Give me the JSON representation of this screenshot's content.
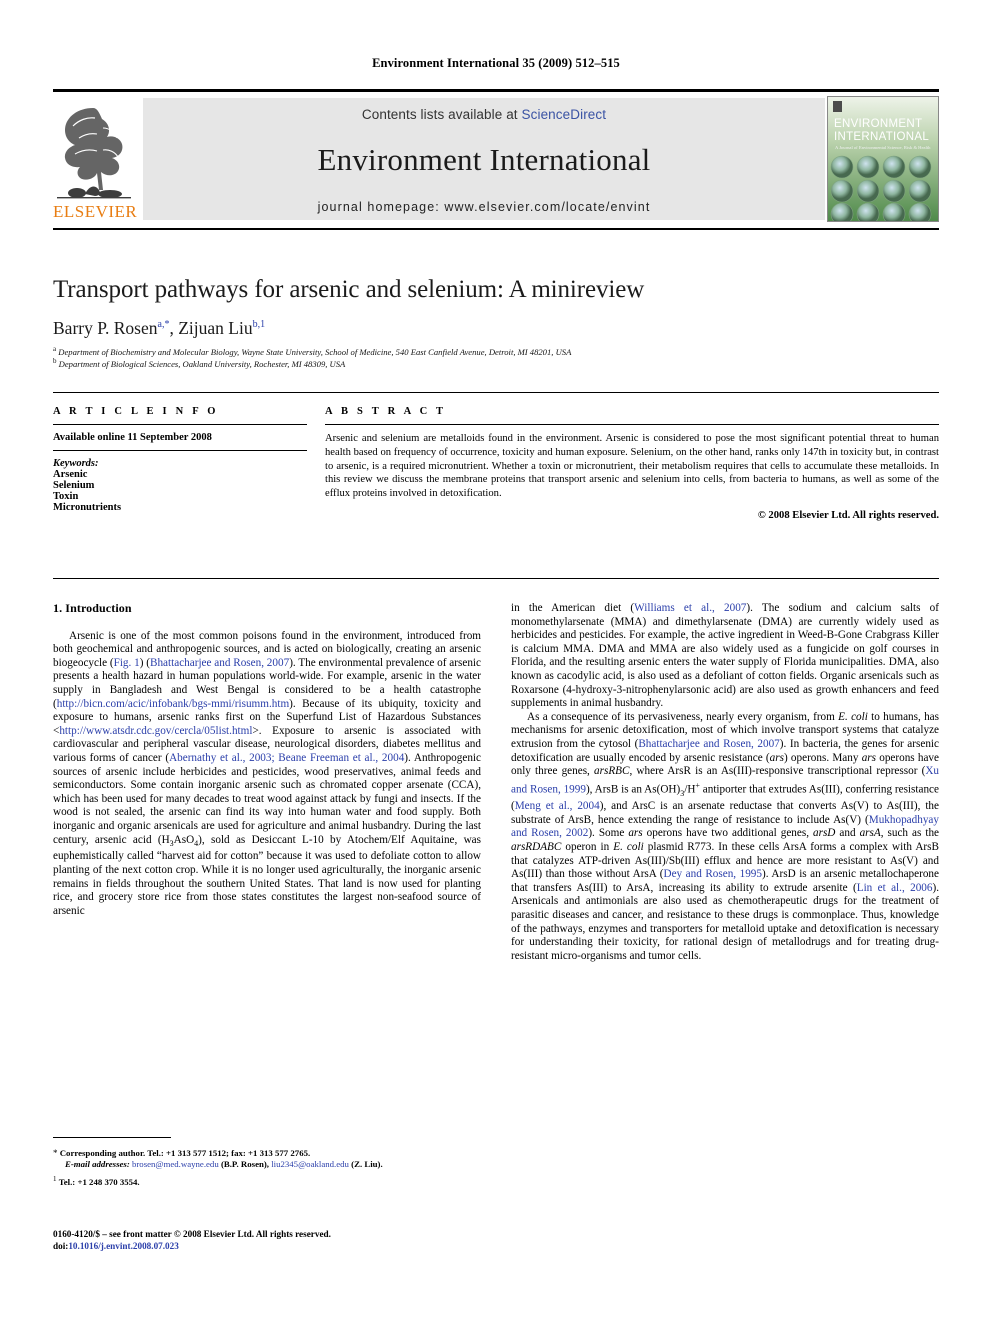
{
  "running_head": "Environment International 35 (2009) 512–515",
  "masthead": {
    "contents_prefix": "Contents lists available at ",
    "sciencedirect": "ScienceDirect",
    "journal_name": "Environment International",
    "homepage": "journal homepage: www.elsevier.com/locate/envint",
    "publisher_logo_text": "ELSEVIER",
    "cover_title_line1": "ENVIRONMENT",
    "cover_title_line2": "INTERNATIONAL",
    "cover_subtitle": "A Journal of Environmental Science, Risk & Health",
    "link_color": "#3A53A4"
  },
  "article": {
    "title": "Transport pathways for arsenic and selenium: A minireview",
    "authors_part1": "Barry P. Rosen",
    "authors_sup1": "a,*",
    "authors_sep": ", ",
    "authors_part2": "Zijuan Liu",
    "authors_sup2": "b,1",
    "affiliation_a_mark": "a",
    "affiliation_a": "Department of Biochemistry and Molecular Biology, Wayne State University, School of Medicine, 540 East Canfield Avenue, Detroit, MI 48201, USA",
    "affiliation_b_mark": "b",
    "affiliation_b": "Department of Biological Sciences, Oakland University, Rochester, MI 48309, USA"
  },
  "info": {
    "heading": "A R T I C L E    I N F O",
    "available_online": "Available online 11 September 2008",
    "keywords_label": "Keywords:",
    "keywords": [
      "Arsenic",
      "Selenium",
      "Toxin",
      "Micronutrients"
    ]
  },
  "abstract": {
    "heading": "A B S T R A C T",
    "text": "Arsenic and selenium are metalloids found in the environment. Arsenic is considered to pose the most significant potential threat to human health based on frequency of occurrence, toxicity and human exposure. Selenium, on the other hand, ranks only 147th in toxicity but, in contrast to arsenic, is a required micronutrient. Whether a toxin or micronutrient, their metabolism requires that cells to accumulate these metalloids. In this review we discuss the membrane proteins that transport arsenic and selenium into cells, from bacteria to humans, as well as some of the efflux proteins involved in detoxification.",
    "copyright": "© 2008 Elsevier Ltd. All rights reserved."
  },
  "body": {
    "section1_heading": "1. Introduction",
    "left_p1_a": "Arsenic is one of the most common poisons found in the environment, introduced from both geochemical and anthropogenic sources, and is acted on biologically, creating an arsenic biogeocycle (",
    "left_fig1": "Fig. 1",
    "left_p1_b": ") (",
    "left_ref1": "Bhattacharjee and Rosen, 2007",
    "left_p1_c": "). The environmental prevalence of arsenic presents a health hazard in human populations world-wide. For example, arsenic in the water supply in Bangladesh and West Bengal is considered to be a health catastrophe (",
    "left_url1": "http://bicn.com/acic/infobank/bgs-mmi/risumm.htm",
    "left_p1_d": "). Because of its ubiquity, toxicity and exposure to humans, arsenic ranks first on the Superfund List of Hazardous Substances <",
    "left_url2": "http://www.atsdr.cdc.gov/cercla/05list.html",
    "left_p1_e": ">. Exposure to arsenic is associated with cardiovascular and peripheral vascular disease, neurological disorders, diabetes mellitus and various forms of cancer (",
    "left_ref2": "Abernathy et al., 2003; Beane Freeman et al., 2004",
    "left_p1_f": "). Anthropogenic sources of arsenic include herbicides and pesticides, wood preservatives, animal feeds and semiconductors. Some contain inorganic arsenic such as chromated copper arsenate (CCA), which has been used for many decades to treat wood against attack by fungi and insects. If the wood is not sealed, the arsenic can find its way into human water and food supply. Both inorganic and organic arsenicals are used for agriculture and animal husbandry. During the last century, arsenic acid (H",
    "left_chem_sub": "3",
    "left_p1_g": "AsO",
    "left_chem_sub2": "4",
    "left_p1_h": "), sold as Desiccant L-10 by Atochem/Elf Aquitaine, was euphemistically called “harvest aid for cotton” because it was used to defoliate cotton to allow planting of the next cotton crop. While it is no longer used agriculturally, the inorganic arsenic remains in fields throughout the southern United States. That land is now used for planting rice, and grocery store rice from those states constitutes the largest non-seafood source of arsenic",
    "right_p1_a": "in the American diet (",
    "right_ref1": "Williams et al., 2007",
    "right_p1_b": "). The sodium and calcium salts of monomethylarsenate (MMA) and dimethylarsenate (DMA) are currently widely used as herbicides and pesticides. For example, the active ingredient in Weed-B-Gone Crabgrass Killer is calcium MMA. DMA and MMA are also widely used as a fungicide on golf courses in Florida, and the resulting arsenic enters the water supply of Florida municipalities. DMA, also known as cacodylic acid, is also used as a defoliant of cotton fields. Organic arsenicals such as Roxarsone (4-hydroxy-3-nitrophenylarsonic acid) are also used as growth enhancers and feed supplements in animal husbandry.",
    "right_p2_a": "As a consequence of its pervasiveness, nearly every organism, from ",
    "right_ecoli1": "E. coli",
    "right_p2_b": " to humans, has mechanisms for arsenic detoxification, most of which involve transport systems that catalyze extrusion from the cytosol (",
    "right_ref2": "Bhattacharjee and Rosen, 2007",
    "right_p2_c": "). In bacteria, the genes for arsenic detoxification are usually encoded by arsenic resistance (",
    "right_ars1": "ars",
    "right_p2_d": ") operons. Many ",
    "right_ars2": "ars",
    "right_p2_e": " operons have only three genes, ",
    "right_arsRBC": "arsRBC",
    "right_p2_f": ", where ArsR is an As(III)-responsive transcriptional repressor (",
    "right_ref3": "Xu and Rosen, 1999",
    "right_p2_g": "), ArsB is an As(OH)",
    "right_p2_g_sub": "3",
    "right_p2_g2": "/H",
    "right_p2_g_sup": "+",
    "right_p2_h": " antiporter that extrudes As(III), conferring resistance (",
    "right_ref4": "Meng et al., 2004",
    "right_p2_i": "), and ArsC is an arsenate reductase that converts As(V) to As(III), the substrate of ArsB, hence extending the range of resistance to include As(V) (",
    "right_ref5": "Mukhopadhyay and Rosen, 2002",
    "right_p2_j": "). Some ",
    "right_ars3": "ars",
    "right_p2_k": " operons have two additional genes, ",
    "right_arsD": "arsD",
    "right_p2_l": " and ",
    "right_arsA": "arsA",
    "right_p2_m": ", such as the ",
    "right_arsRDABC": "arsRDABC",
    "right_p2_n": " operon in ",
    "right_ecoli2": "E. coli",
    "right_p2_o": " plasmid R773. In these cells ArsA forms a complex with ArsB that catalyzes ATP-driven As(III)/Sb(III) efflux and hence are more resistant to As(V) and As(III) than those without ArsA (",
    "right_ref6": "Dey and Rosen, 1995",
    "right_p2_p": "). ArsD is an arsenic metallochaperone that transfers As(III) to ArsA, increasing its ability to extrude arsenite (",
    "right_ref7": "Lin et al., 2006",
    "right_p2_q": "). Arsenicals and antimonials are also used as chemotherapeutic drugs for the treatment of parasitic diseases and cancer, and resistance to these drugs is commonplace. Thus, knowledge of the pathways, enzymes and transporters for metalloid uptake and detoxification is necessary for understanding their toxicity, for rational design of metallodrugs and for treating drug-resistant micro-organisms and tumor cells."
  },
  "footnotes": {
    "corresponding_mark": "*",
    "corresponding": "Corresponding author. Tel.: +1 313 577 1512; fax: +1 313 577 2765.",
    "email_label": "E-mail addresses:",
    "email1": "brosen@med.wayne.edu",
    "email1_attr": "(B.P. Rosen),",
    "email2": "liu2345@oakland.edu",
    "email2_attr": "(Z. Liu).",
    "fn1_mark": "1",
    "fn1": "Tel.: +1 248 370 3554."
  },
  "imprint": {
    "line1": "0160-4120/$ – see front matter © 2008 Elsevier Ltd. All rights reserved.",
    "doi_label": "doi:",
    "doi": "10.1016/j.envint.2008.07.023"
  }
}
